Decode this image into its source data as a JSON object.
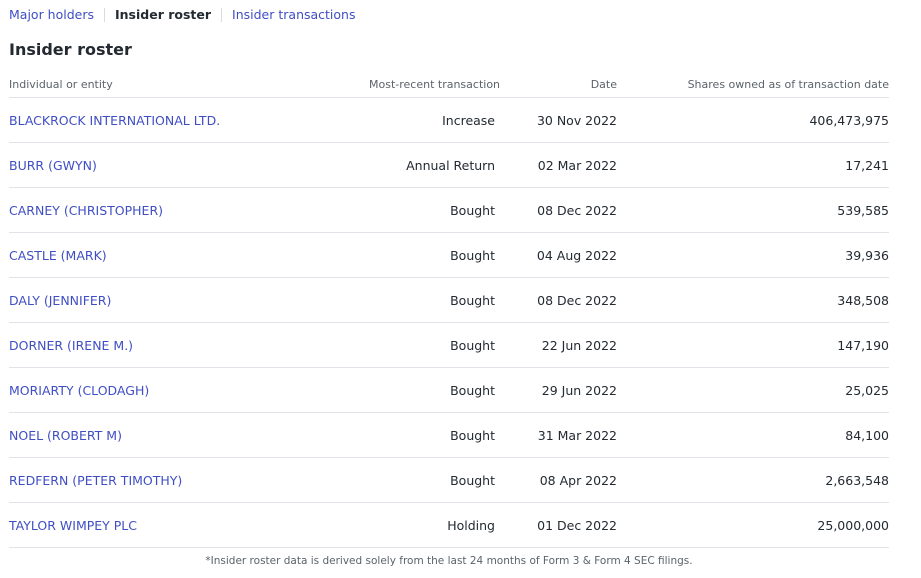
{
  "tabs": [
    {
      "label": "Major holders",
      "active": false
    },
    {
      "label": "Insider roster",
      "active": true
    },
    {
      "label": "Insider transactions",
      "active": false
    }
  ],
  "title": "Insider roster",
  "table": {
    "headers": {
      "name": "Individual or entity",
      "transaction": "Most-recent transaction",
      "date": "Date",
      "shares": "Shares owned as of transaction date"
    },
    "rows": [
      {
        "name": "BLACKROCK INTERNATIONAL LTD.",
        "transaction": "Increase",
        "date": "30 Nov 2022",
        "shares": "406,473,975"
      },
      {
        "name": "BURR (GWYN)",
        "transaction": "Annual Return",
        "date": "02 Mar 2022",
        "shares": "17,241"
      },
      {
        "name": "CARNEY (CHRISTOPHER)",
        "transaction": "Bought",
        "date": "08 Dec 2022",
        "shares": "539,585"
      },
      {
        "name": "CASTLE (MARK)",
        "transaction": "Bought",
        "date": "04 Aug 2022",
        "shares": "39,936"
      },
      {
        "name": "DALY (JENNIFER)",
        "transaction": "Bought",
        "date": "08 Dec 2022",
        "shares": "348,508"
      },
      {
        "name": "DORNER (IRENE M.)",
        "transaction": "Bought",
        "date": "22 Jun 2022",
        "shares": "147,190"
      },
      {
        "name": "MORIARTY (CLODAGH)",
        "transaction": "Bought",
        "date": "29 Jun 2022",
        "shares": "25,025"
      },
      {
        "name": "NOEL (ROBERT M)",
        "transaction": "Bought",
        "date": "31 Mar 2022",
        "shares": "84,100"
      },
      {
        "name": "REDFERN (PETER TIMOTHY)",
        "transaction": "Bought",
        "date": "08 Apr 2022",
        "shares": "2,663,548"
      },
      {
        "name": "TAYLOR WIMPEY PLC",
        "transaction": "Holding",
        "date": "01 Dec 2022",
        "shares": "25,000,000"
      }
    ]
  },
  "footnote": "*Insider roster data is derived solely from the last 24 months of Form 3 & Form 4 SEC filings.",
  "colors": {
    "link": "#3f4ec4",
    "text": "#232a31",
    "muted": "#5b636a",
    "divider": "#e0e4e9"
  }
}
